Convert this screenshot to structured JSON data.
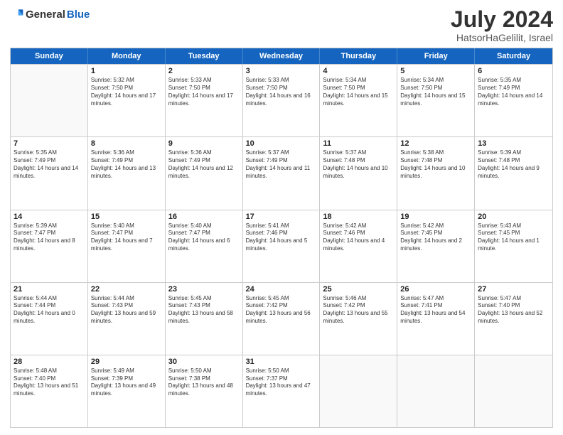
{
  "logo": {
    "text_general": "General",
    "text_blue": "Blue"
  },
  "title": "July 2024",
  "subtitle": "HatsorHaGelilit, Israel",
  "header_days": [
    "Sunday",
    "Monday",
    "Tuesday",
    "Wednesday",
    "Thursday",
    "Friday",
    "Saturday"
  ],
  "weeks": [
    [
      {
        "day": "",
        "empty": true
      },
      {
        "day": "1",
        "sunrise": "Sunrise: 5:32 AM",
        "sunset": "Sunset: 7:50 PM",
        "daylight": "Daylight: 14 hours and 17 minutes."
      },
      {
        "day": "2",
        "sunrise": "Sunrise: 5:33 AM",
        "sunset": "Sunset: 7:50 PM",
        "daylight": "Daylight: 14 hours and 17 minutes."
      },
      {
        "day": "3",
        "sunrise": "Sunrise: 5:33 AM",
        "sunset": "Sunset: 7:50 PM",
        "daylight": "Daylight: 14 hours and 16 minutes."
      },
      {
        "day": "4",
        "sunrise": "Sunrise: 5:34 AM",
        "sunset": "Sunset: 7:50 PM",
        "daylight": "Daylight: 14 hours and 15 minutes."
      },
      {
        "day": "5",
        "sunrise": "Sunrise: 5:34 AM",
        "sunset": "Sunset: 7:50 PM",
        "daylight": "Daylight: 14 hours and 15 minutes."
      },
      {
        "day": "6",
        "sunrise": "Sunrise: 5:35 AM",
        "sunset": "Sunset: 7:49 PM",
        "daylight": "Daylight: 14 hours and 14 minutes."
      }
    ],
    [
      {
        "day": "7",
        "sunrise": "Sunrise: 5:35 AM",
        "sunset": "Sunset: 7:49 PM",
        "daylight": "Daylight: 14 hours and 14 minutes."
      },
      {
        "day": "8",
        "sunrise": "Sunrise: 5:36 AM",
        "sunset": "Sunset: 7:49 PM",
        "daylight": "Daylight: 14 hours and 13 minutes."
      },
      {
        "day": "9",
        "sunrise": "Sunrise: 5:36 AM",
        "sunset": "Sunset: 7:49 PM",
        "daylight": "Daylight: 14 hours and 12 minutes."
      },
      {
        "day": "10",
        "sunrise": "Sunrise: 5:37 AM",
        "sunset": "Sunset: 7:49 PM",
        "daylight": "Daylight: 14 hours and 11 minutes."
      },
      {
        "day": "11",
        "sunrise": "Sunrise: 5:37 AM",
        "sunset": "Sunset: 7:48 PM",
        "daylight": "Daylight: 14 hours and 10 minutes."
      },
      {
        "day": "12",
        "sunrise": "Sunrise: 5:38 AM",
        "sunset": "Sunset: 7:48 PM",
        "daylight": "Daylight: 14 hours and 10 minutes."
      },
      {
        "day": "13",
        "sunrise": "Sunrise: 5:39 AM",
        "sunset": "Sunset: 7:48 PM",
        "daylight": "Daylight: 14 hours and 9 minutes."
      }
    ],
    [
      {
        "day": "14",
        "sunrise": "Sunrise: 5:39 AM",
        "sunset": "Sunset: 7:47 PM",
        "daylight": "Daylight: 14 hours and 8 minutes."
      },
      {
        "day": "15",
        "sunrise": "Sunrise: 5:40 AM",
        "sunset": "Sunset: 7:47 PM",
        "daylight": "Daylight: 14 hours and 7 minutes."
      },
      {
        "day": "16",
        "sunrise": "Sunrise: 5:40 AM",
        "sunset": "Sunset: 7:47 PM",
        "daylight": "Daylight: 14 hours and 6 minutes."
      },
      {
        "day": "17",
        "sunrise": "Sunrise: 5:41 AM",
        "sunset": "Sunset: 7:46 PM",
        "daylight": "Daylight: 14 hours and 5 minutes."
      },
      {
        "day": "18",
        "sunrise": "Sunrise: 5:42 AM",
        "sunset": "Sunset: 7:46 PM",
        "daylight": "Daylight: 14 hours and 4 minutes."
      },
      {
        "day": "19",
        "sunrise": "Sunrise: 5:42 AM",
        "sunset": "Sunset: 7:45 PM",
        "daylight": "Daylight: 14 hours and 2 minutes."
      },
      {
        "day": "20",
        "sunrise": "Sunrise: 5:43 AM",
        "sunset": "Sunset: 7:45 PM",
        "daylight": "Daylight: 14 hours and 1 minute."
      }
    ],
    [
      {
        "day": "21",
        "sunrise": "Sunrise: 5:44 AM",
        "sunset": "Sunset: 7:44 PM",
        "daylight": "Daylight: 14 hours and 0 minutes."
      },
      {
        "day": "22",
        "sunrise": "Sunrise: 5:44 AM",
        "sunset": "Sunset: 7:43 PM",
        "daylight": "Daylight: 13 hours and 59 minutes."
      },
      {
        "day": "23",
        "sunrise": "Sunrise: 5:45 AM",
        "sunset": "Sunset: 7:43 PM",
        "daylight": "Daylight: 13 hours and 58 minutes."
      },
      {
        "day": "24",
        "sunrise": "Sunrise: 5:45 AM",
        "sunset": "Sunset: 7:42 PM",
        "daylight": "Daylight: 13 hours and 56 minutes."
      },
      {
        "day": "25",
        "sunrise": "Sunrise: 5:46 AM",
        "sunset": "Sunset: 7:42 PM",
        "daylight": "Daylight: 13 hours and 55 minutes."
      },
      {
        "day": "26",
        "sunrise": "Sunrise: 5:47 AM",
        "sunset": "Sunset: 7:41 PM",
        "daylight": "Daylight: 13 hours and 54 minutes."
      },
      {
        "day": "27",
        "sunrise": "Sunrise: 5:47 AM",
        "sunset": "Sunset: 7:40 PM",
        "daylight": "Daylight: 13 hours and 52 minutes."
      }
    ],
    [
      {
        "day": "28",
        "sunrise": "Sunrise: 5:48 AM",
        "sunset": "Sunset: 7:40 PM",
        "daylight": "Daylight: 13 hours and 51 minutes."
      },
      {
        "day": "29",
        "sunrise": "Sunrise: 5:49 AM",
        "sunset": "Sunset: 7:39 PM",
        "daylight": "Daylight: 13 hours and 49 minutes."
      },
      {
        "day": "30",
        "sunrise": "Sunrise: 5:50 AM",
        "sunset": "Sunset: 7:38 PM",
        "daylight": "Daylight: 13 hours and 48 minutes."
      },
      {
        "day": "31",
        "sunrise": "Sunrise: 5:50 AM",
        "sunset": "Sunset: 7:37 PM",
        "daylight": "Daylight: 13 hours and 47 minutes."
      },
      {
        "day": "",
        "empty": true
      },
      {
        "day": "",
        "empty": true
      },
      {
        "day": "",
        "empty": true
      }
    ]
  ]
}
